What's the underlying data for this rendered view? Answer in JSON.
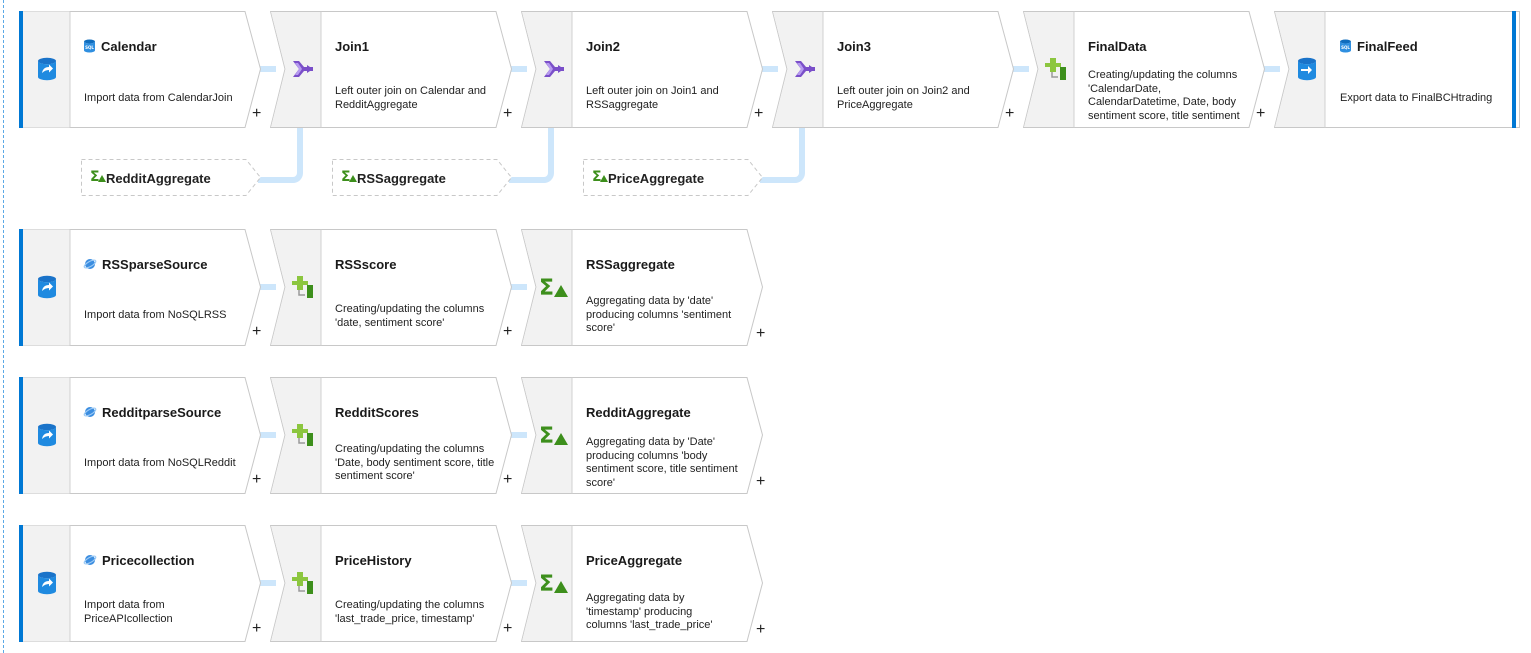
{
  "pipeline": {
    "calendar": {
      "title": "Calendar",
      "desc": "Import data from CalendarJoin"
    },
    "join1": {
      "title": "Join1",
      "desc": "Left outer join on Calendar and RedditAggregate"
    },
    "join2": {
      "title": "Join2",
      "desc": "Left outer join on Join1 and RSSaggregate"
    },
    "join3": {
      "title": "Join3",
      "desc": "Left outer join on Join2 and PriceAggregate"
    },
    "finaldata": {
      "title": "FinalData",
      "desc": "Creating/updating the columns 'CalendarDate, CalendarDatetime, Date, body sentiment score, title sentiment score, last_trade_price'"
    },
    "finalfeed": {
      "title": "FinalFeed",
      "desc": "Export data to FinalBCHtrading"
    }
  },
  "refs": {
    "reddit": "RedditAggregate",
    "rss": "RSSaggregate",
    "price": "PriceAggregate"
  },
  "rss_row": {
    "source": {
      "title": "RSSparseSource",
      "desc": "Import data from NoSQLRSS"
    },
    "derive": {
      "title": "RSSscore",
      "desc": "Creating/updating the columns 'date, sentiment score'"
    },
    "agg": {
      "title": "RSSaggregate",
      "desc": "Aggregating data by 'date' producing columns 'sentiment score'"
    }
  },
  "reddit_row": {
    "source": {
      "title": "RedditparseSource",
      "desc": "Import data from NoSQLReddit"
    },
    "derive": {
      "title": "RedditScores",
      "desc": "Creating/updating the columns 'Date, body sentiment score, title sentiment score'"
    },
    "agg": {
      "title": "RedditAggregate",
      "desc": "Aggregating data by 'Date' producing columns 'body sentiment score, title sentiment score'"
    }
  },
  "price_row": {
    "source": {
      "title": "Pricecollection",
      "desc": "Import data from PriceAPIcollection"
    },
    "derive": {
      "title": "PriceHistory",
      "desc": "Creating/updating the columns 'last_trade_price, timestamp'"
    },
    "agg": {
      "title": "PriceAggregate",
      "desc": "Aggregating data by 'timestamp' producing columns 'last_trade_price'"
    }
  },
  "add_label": "+",
  "colors": {
    "accent": "#0078d4",
    "connector": "#cde6fb",
    "join": "#7a4fc9",
    "derive": "#5ea51f",
    "agg": "#3d8f1c"
  }
}
